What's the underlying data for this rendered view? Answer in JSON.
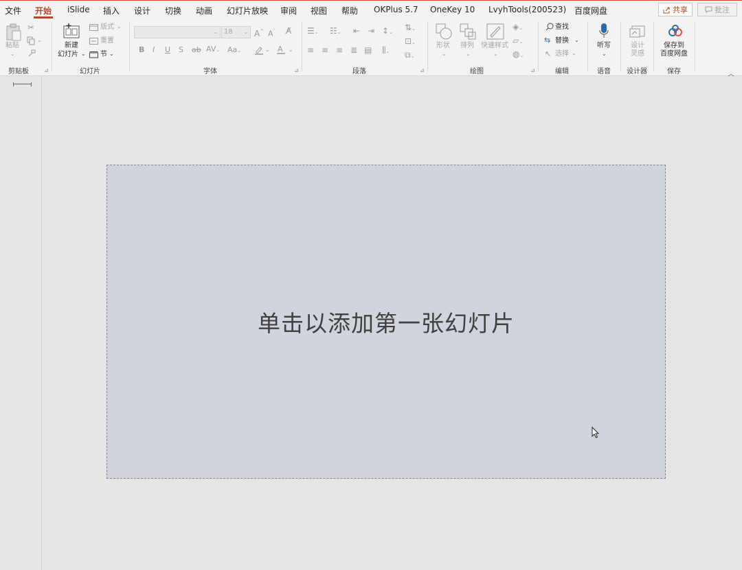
{
  "menu": {
    "tabs": [
      {
        "label": "文件",
        "active": false
      },
      {
        "label": "开始",
        "active": true
      },
      {
        "label": "iSlide",
        "active": false
      },
      {
        "label": "插入",
        "active": false
      },
      {
        "label": "设计",
        "active": false
      },
      {
        "label": "切换",
        "active": false
      },
      {
        "label": "动画",
        "active": false
      },
      {
        "label": "幻灯片放映",
        "active": false
      },
      {
        "label": "审阅",
        "active": false
      },
      {
        "label": "视图",
        "active": false
      },
      {
        "label": "帮助",
        "active": false
      },
      {
        "label": "OKPlus 5.7",
        "active": false
      },
      {
        "label": "OneKey 10",
        "active": false
      },
      {
        "label": "LvyhTools(200523)",
        "active": false
      },
      {
        "label": "百度网盘",
        "active": false
      }
    ],
    "share_label": "共享",
    "comment_label": "批注"
  },
  "ribbon": {
    "clipboard": {
      "paste_label": "粘贴",
      "group_label": "剪贴板"
    },
    "slides": {
      "new_slide_line1": "新建",
      "new_slide_line2": "幻灯片",
      "layout_label": "版式",
      "reset_label": "重置",
      "section_label": "节",
      "group_label": "幻灯片"
    },
    "font": {
      "font_size": "18",
      "change_case_label": "Aa",
      "group_label": "字体"
    },
    "paragraph": {
      "group_label": "段落"
    },
    "drawing": {
      "shapes_label": "形状",
      "arrange_label": "排列",
      "quick_styles_label": "快速样式",
      "group_label": "绘图"
    },
    "editing": {
      "find_label": "查找",
      "replace_label": "替换",
      "select_label": "选择",
      "group_label": "编辑"
    },
    "voice": {
      "dictate_label": "听写",
      "group_label": "语音"
    },
    "designer": {
      "ideas_line1": "设计",
      "ideas_line2": "灵感",
      "group_label": "设计器"
    },
    "save": {
      "save_line1": "保存到",
      "save_line2": "百度网盘",
      "group_label": "保存"
    }
  },
  "slide": {
    "placeholder_text": "单击以添加第一张幻灯片"
  },
  "colors": {
    "accent": "#b7472a",
    "slide_placeholder": "#d0d4dd",
    "canvas": "#e6e6e6"
  },
  "icons": [
    "paste-icon",
    "cut-icon",
    "copy-icon",
    "format-painter-icon",
    "new-slide-icon",
    "layout-icon",
    "reset-icon",
    "section-icon",
    "shapes-icon",
    "arrange-icon",
    "quick-styles-icon",
    "find-icon",
    "replace-icon",
    "select-icon",
    "microphone-icon",
    "design-ideas-icon",
    "baidu-cloud-icon",
    "share-icon",
    "comment-icon",
    "cursor-icon"
  ]
}
